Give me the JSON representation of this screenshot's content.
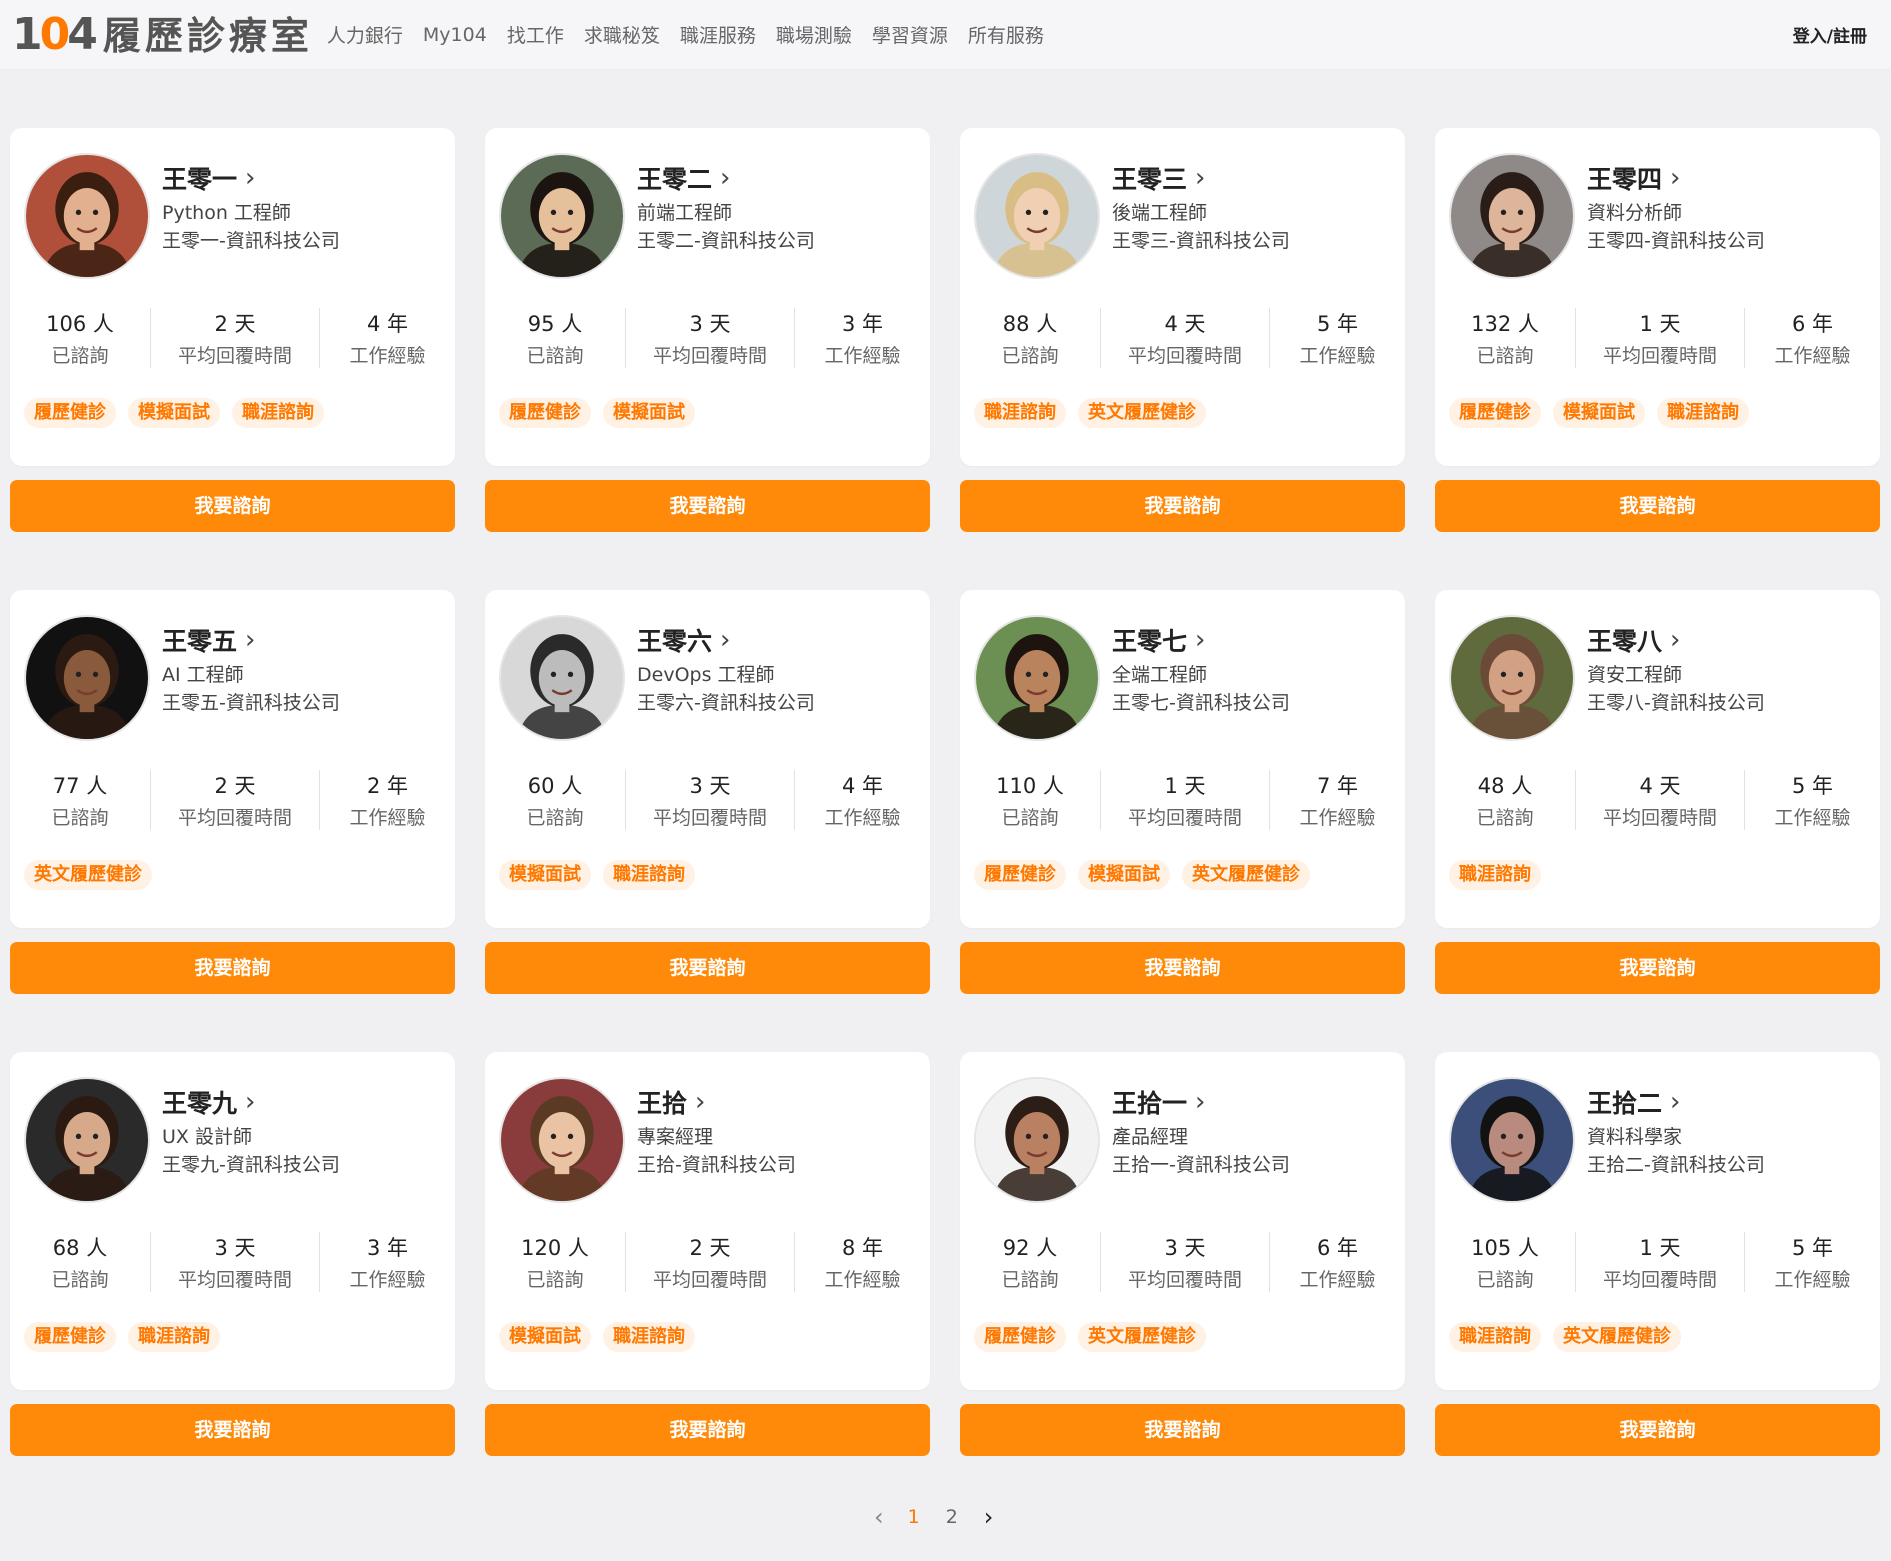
{
  "header": {
    "logo_number": "104",
    "logo_text": "履歷診療室",
    "nav": [
      "人力銀行",
      "My104",
      "找工作",
      "求職秘笈",
      "職涯服務",
      "職場測驗",
      "學習資源",
      "所有服務"
    ],
    "login": "登入/註冊"
  },
  "colors": {
    "accent": "#ff8a0a",
    "tag_bg": "#fff1e4",
    "tag_text": "#ff7800"
  },
  "stat_labels": {
    "consults": "已諮詢",
    "reply": "平均回覆時間",
    "experience": "工作經驗"
  },
  "consult_label": "我要諮詢",
  "consultants": [
    {
      "name": "王零一",
      "title": "Python 工程師",
      "company": "王零一-資訊科技公司",
      "consults": "106 人",
      "reply": "2 天",
      "experience": "4 年",
      "tags": [
        "履歷健診",
        "模擬面試",
        "職涯諮詢"
      ],
      "avatar": {
        "bg": "#b0503a",
        "skin": "#e2b08e",
        "hair": "#3a1e10"
      }
    },
    {
      "name": "王零二",
      "title": "前端工程師",
      "company": "王零二-資訊科技公司",
      "consults": "95 人",
      "reply": "3 天",
      "experience": "3 年",
      "tags": [
        "履歷健診",
        "模擬面試"
      ],
      "avatar": {
        "bg": "#5b6b56",
        "skin": "#e6c09a",
        "hair": "#1b1410"
      }
    },
    {
      "name": "王零三",
      "title": "後端工程師",
      "company": "王零三-資訊科技公司",
      "consults": "88 人",
      "reply": "4 天",
      "experience": "5 年",
      "tags": [
        "職涯諮詢",
        "英文履歷健診"
      ],
      "avatar": {
        "bg": "#cfd6d9",
        "skin": "#f0cfb2",
        "hair": "#d8bd84"
      }
    },
    {
      "name": "王零四",
      "title": "資料分析師",
      "company": "王零四-資訊科技公司",
      "consults": "132 人",
      "reply": "1 天",
      "experience": "6 年",
      "tags": [
        "履歷健診",
        "模擬面試",
        "職涯諮詢"
      ],
      "avatar": {
        "bg": "#8f8a87",
        "skin": "#dcb59a",
        "hair": "#2a1d18"
      }
    },
    {
      "name": "王零五",
      "title": "AI 工程師",
      "company": "王零五-資訊科技公司",
      "consults": "77 人",
      "reply": "2 天",
      "experience": "2 年",
      "tags": [
        "英文履歷健診"
      ],
      "avatar": {
        "bg": "#111111",
        "skin": "#8a5a3c",
        "hair": "#2b1a12"
      }
    },
    {
      "name": "王零六",
      "title": "DevOps 工程師",
      "company": "王零六-資訊科技公司",
      "consults": "60 人",
      "reply": "3 天",
      "experience": "4 年",
      "tags": [
        "模擬面試",
        "職涯諮詢"
      ],
      "avatar": {
        "bg": "#d8d8d8",
        "skin": "#bcbcbc",
        "hair": "#2a2a2a"
      }
    },
    {
      "name": "王零七",
      "title": "全端工程師",
      "company": "王零七-資訊科技公司",
      "consults": "110 人",
      "reply": "1 天",
      "experience": "7 年",
      "tags": [
        "履歷健診",
        "模擬面試",
        "英文履歷健診"
      ],
      "avatar": {
        "bg": "#6c8f53",
        "skin": "#b9835e",
        "hair": "#1d140f"
      }
    },
    {
      "name": "王零八",
      "title": "資安工程師",
      "company": "王零八-資訊科技公司",
      "consults": "48 人",
      "reply": "4 天",
      "experience": "5 年",
      "tags": [
        "職涯諮詢"
      ],
      "avatar": {
        "bg": "#5f6b3c",
        "skin": "#d2a184",
        "hair": "#6b4b38"
      }
    },
    {
      "name": "王零九",
      "title": "UX 設計師",
      "company": "王零九-資訊科技公司",
      "consults": "68 人",
      "reply": "3 天",
      "experience": "3 年",
      "tags": [
        "履歷健診",
        "職涯諮詢"
      ],
      "avatar": {
        "bg": "#2a2a2a",
        "skin": "#d6a98b",
        "hair": "#2a1a12"
      }
    },
    {
      "name": "王拾",
      "title": "專案經理",
      "company": "王拾-資訊科技公司",
      "consults": "120 人",
      "reply": "2 天",
      "experience": "8 年",
      "tags": [
        "模擬面試",
        "職涯諮詢"
      ],
      "avatar": {
        "bg": "#8a3c3c",
        "skin": "#eac3a4",
        "hair": "#5a3a22"
      }
    },
    {
      "name": "王拾一",
      "title": "產品經理",
      "company": "王拾一-資訊科技公司",
      "consults": "92 人",
      "reply": "3 天",
      "experience": "6 年",
      "tags": [
        "履歷健診",
        "英文履歷健診"
      ],
      "avatar": {
        "bg": "#f2f2f2",
        "skin": "#b98062",
        "hair": "#2c1d16"
      }
    },
    {
      "name": "王拾二",
      "title": "資料科學家",
      "company": "王拾二-資訊科技公司",
      "consults": "105 人",
      "reply": "1 天",
      "experience": "5 年",
      "tags": [
        "職涯諮詢",
        "英文履歷健診"
      ],
      "avatar": {
        "bg": "#3b4f7a",
        "skin": "#b98a7e",
        "hair": "#121212"
      }
    }
  ],
  "pagination": {
    "prev": "‹",
    "pages": [
      "1",
      "2"
    ],
    "current": "1",
    "next": "›"
  }
}
